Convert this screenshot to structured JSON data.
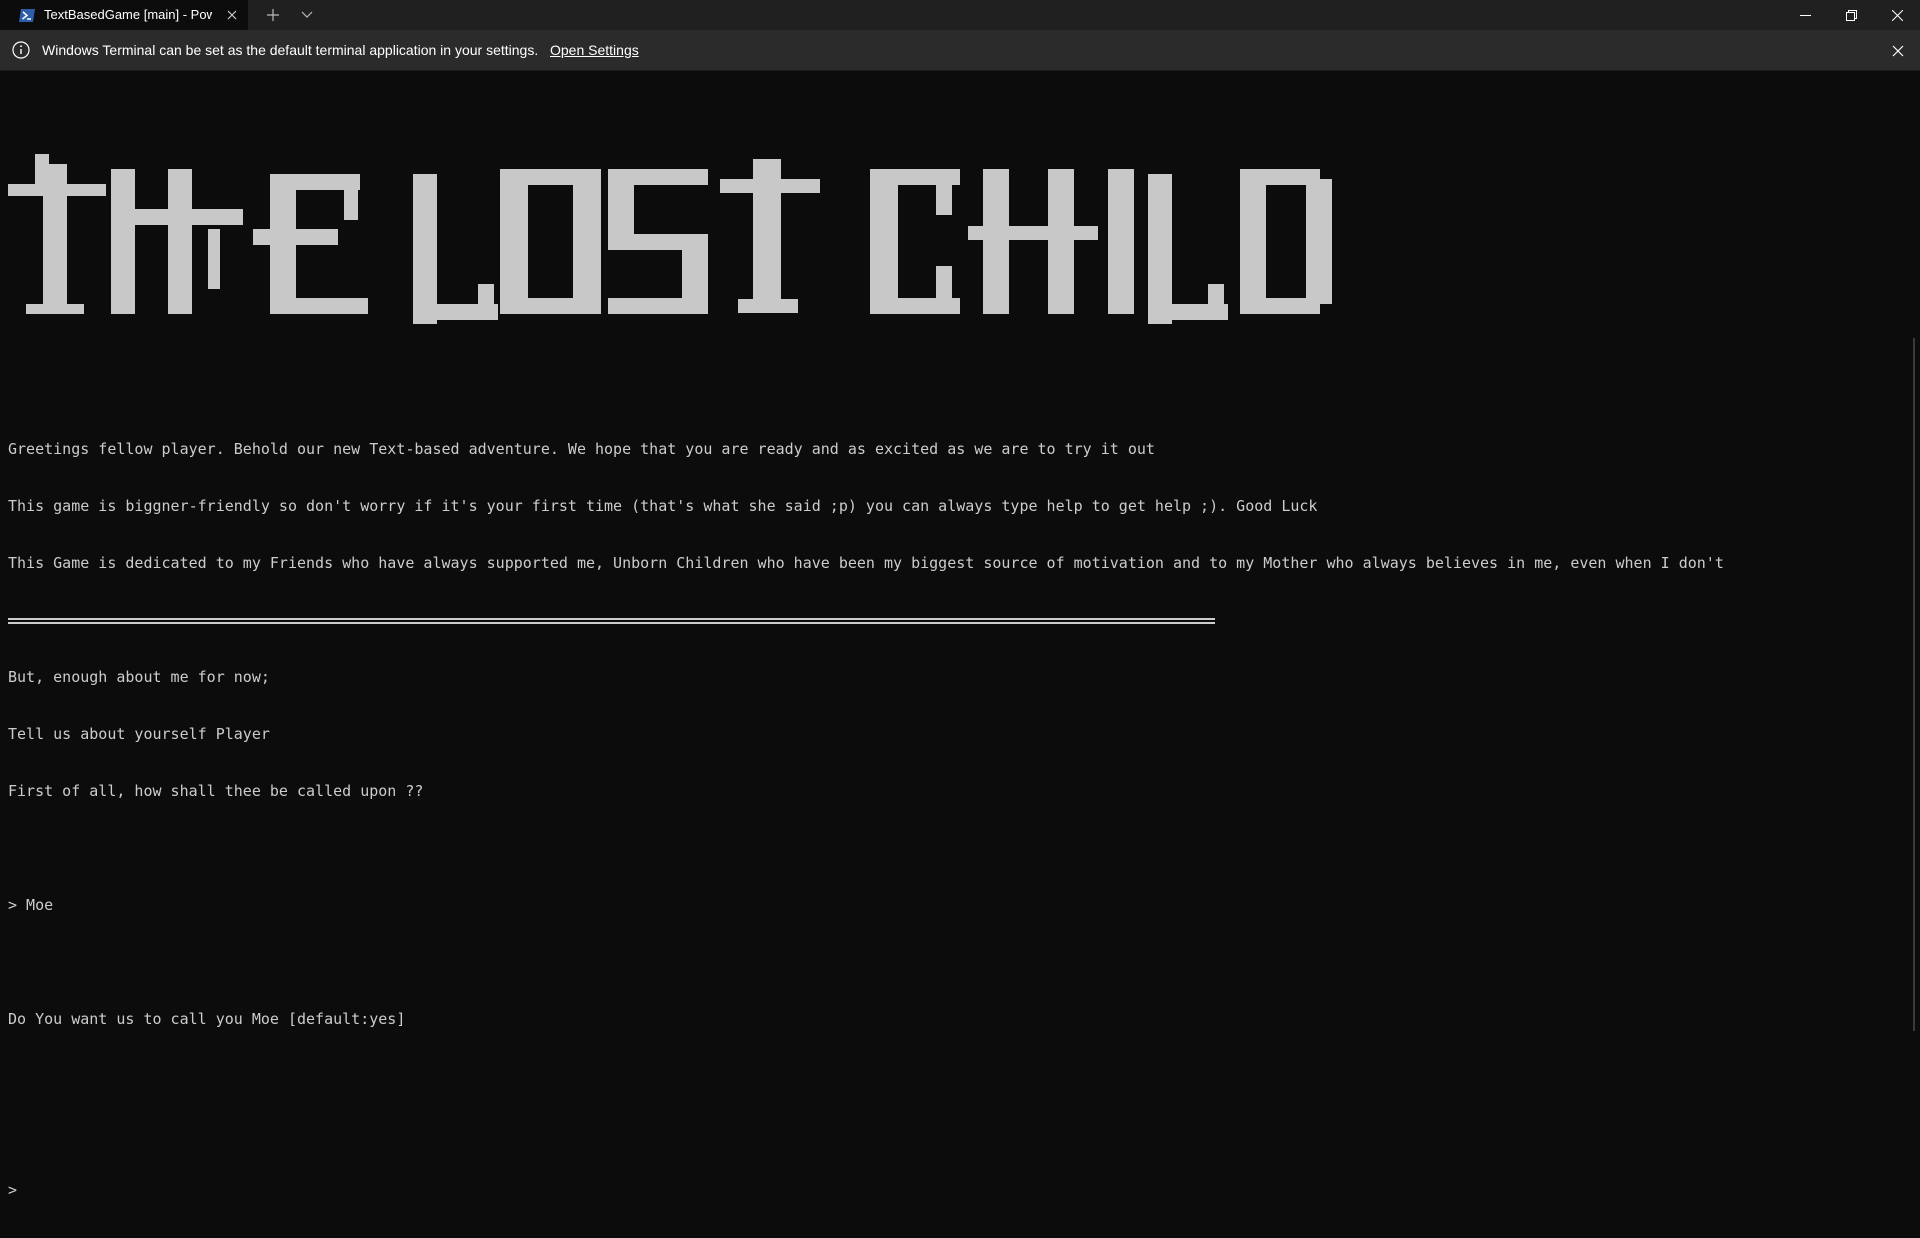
{
  "window": {
    "tab_title": "TextBasedGame [main] - PowerShell",
    "controls": [
      "minimize",
      "restore",
      "close"
    ]
  },
  "infobar": {
    "message": "Windows Terminal can be set as the default terminal application in your settings.",
    "link_label": "Open Settings"
  },
  "terminal": {
    "banner_text": "THE LOST CHILD",
    "lines": [
      "Greetings fellow player. Behold our new Text-based adventure. We hope that you are ready and as excited as we are to try it out",
      "This game is biggner-friendly so don't worry if it's your first time (that's what she said ;p) you can always type help to get help ;). Good Luck",
      "This Game is dedicated to my Friends who have always supported me, Unborn Children who have been my biggest source of motivation and to my Mother who always believes in me, even when I don't"
    ],
    "lines2": [
      "But, enough about me for now;",
      "Tell us about yourself Player",
      "First of all, how shall thee be called upon ??"
    ],
    "input_line": "> Moe",
    "question": "Do You want us to call you Moe [default:yes]",
    "prompt": ">"
  },
  "colors": {
    "background": "#0c0c0c",
    "text": "#cccccc",
    "titlebar": "#202020",
    "infobar": "#2b2b2b"
  },
  "icons": {
    "tab_icon": "powershell-icon",
    "info_icon": "info-icon"
  }
}
